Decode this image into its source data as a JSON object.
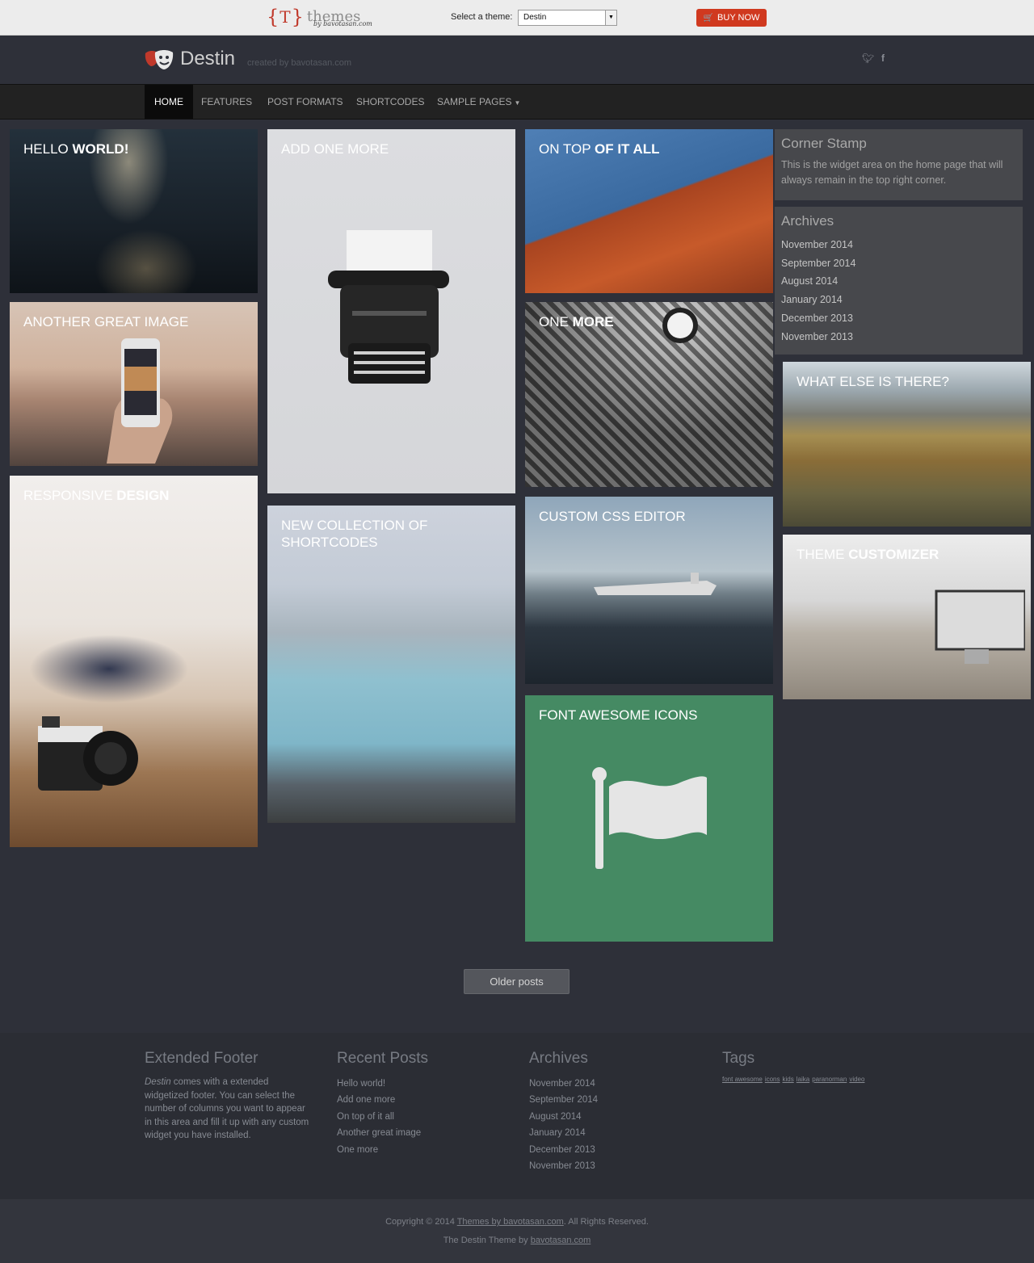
{
  "topbar": {
    "logo_brace_open": "{",
    "logo_letter": "T",
    "logo_brace_close": "}",
    "logo_word": "themes",
    "logo_by": "by bavotasan.com",
    "select_label": "Select a theme:",
    "select_value": "Destin",
    "buy_label": "BUY NOW",
    "buy_color": "#d0391f"
  },
  "header": {
    "logo_icon": "theater-masks-icon",
    "title": "Destin",
    "tagline": "created by bavotasan.com",
    "twitter": "twitter-icon",
    "facebook": "facebook-icon"
  },
  "nav": {
    "items": [
      {
        "label": "HOME"
      },
      {
        "label": "FEATURES"
      },
      {
        "label": "POST FORMATS"
      },
      {
        "label": "SHORTCODES"
      },
      {
        "label": "SAMPLE PAGES"
      }
    ]
  },
  "posts": [
    {
      "light": "HELLO ",
      "bold": "WORLD!"
    },
    {
      "light": "ANOTHER GREAT IMAGE",
      "bold": ""
    },
    {
      "light": "RESPONSIVE ",
      "bold": "DESIGN"
    },
    {
      "light": "ADD ONE MORE",
      "bold": ""
    },
    {
      "light": "NEW COLLECTION OF SHORTCODES",
      "bold": ""
    },
    {
      "light": "ON TOP ",
      "bold": "OF IT ALL"
    },
    {
      "light": "ONE ",
      "bold": "MORE"
    },
    {
      "light": "CUSTOM CSS EDITOR",
      "bold": ""
    },
    {
      "light": "FONT AWESOME ICONS",
      "bold": ""
    },
    {
      "light": "WHAT ELSE IS THERE?",
      "bold": ""
    },
    {
      "light": "THEME ",
      "bold": "CUSTOMIZER"
    }
  ],
  "widgets": {
    "corner_title": "Corner Stamp",
    "corner_text": "This is the widget area on the home page that will always remain in the top right corner.",
    "archives_title": "Archives",
    "archives": [
      "November 2014",
      "September 2014",
      "August 2014",
      "January 2014",
      "December 2013",
      "November 2013"
    ]
  },
  "older_posts": "Older posts",
  "footer": {
    "ext_title": "Extended Footer",
    "ext_em": "Destin",
    "ext_text": " comes with a extended widgetized footer. You can select the number of columns you want to appear in this area and fill it up with any custom widget you have installed.",
    "recent_title": "Recent Posts",
    "recent": [
      "Hello world!",
      "Add one more",
      "On top of it all",
      "Another great image",
      "One more"
    ],
    "archives_title": "Archives",
    "archives": [
      "November 2014",
      "September 2014",
      "August 2014",
      "January 2014",
      "December 2013",
      "November 2013"
    ],
    "tags_title": "Tags",
    "tags": [
      "font awesome",
      "icons",
      "kids",
      "laika",
      "paranorman",
      "video"
    ]
  },
  "bottom": {
    "copy_pre": "Copyright © 2014 ",
    "copy_link": "Themes by bavotasan.com",
    "copy_post": ". All Rights Reserved.",
    "theme_pre": "The Destin Theme by ",
    "theme_link": "bavotasan.com"
  },
  "colors": {
    "flag_tile": "#458a63",
    "background": "#2e3039"
  }
}
